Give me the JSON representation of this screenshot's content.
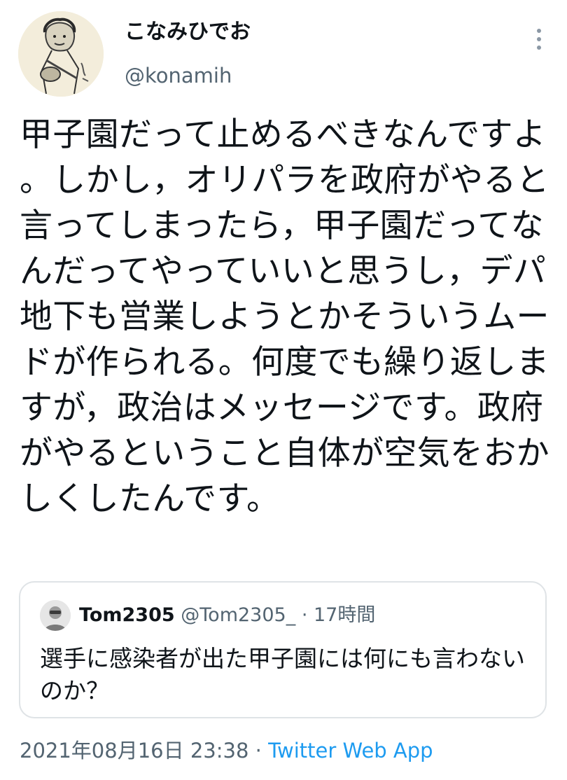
{
  "author": {
    "display_name": "こなみひでお",
    "handle": "@konamih",
    "avatar_icon": "user-avatar-sketch"
  },
  "tweet": {
    "text": "甲子園だって止めるべきなんですよ。しかし，オリパラを政府がやると言ってしまったら，甲子園だってなんだってやっていいと思うし，デパ地下も営業しようとかそういうムードが作られる。何度でも繰り返しますが，政治はメッセージです。政府がやるということ自体が空気をおかしくしたんです。"
  },
  "quoted_tweet": {
    "display_name": "Tom2305",
    "handle": "@Tom2305_",
    "separator": "·",
    "time": "17時間",
    "text": "選手に感染者が出た甲子園には何にも言わないのか？",
    "avatar_icon": "user-avatar-photo"
  },
  "meta": {
    "timestamp": "2021年08月16日 23:38",
    "separator": "·",
    "source": "Twitter Web App"
  },
  "icons": {
    "more": "more-vertical-icon"
  },
  "colors": {
    "text_primary": "#0f1419",
    "text_secondary": "#536471",
    "link": "#1d9bf0",
    "border": "#dfe3e6"
  }
}
